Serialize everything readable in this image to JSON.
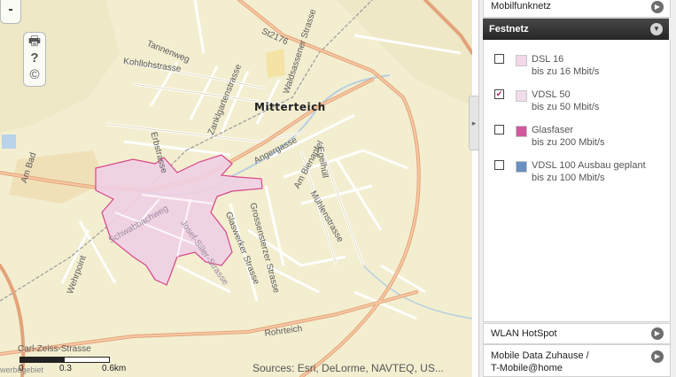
{
  "map": {
    "town_name": "Mitterteich",
    "street_labels": [
      {
        "id": "tannenweg",
        "text": "Tannenweg"
      },
      {
        "id": "kohllohstrasse",
        "text": "Kohllohstrasse"
      },
      {
        "id": "st2176",
        "text": "St2176"
      },
      {
        "id": "waldsassener-strasse",
        "text": "Waldsassener Strasse"
      },
      {
        "id": "zanklgartenstrasse",
        "text": "Zanklgartenstrasse"
      },
      {
        "id": "erbstrasse",
        "text": "Erbstrasse"
      },
      {
        "id": "angergasse",
        "text": "Angergasse"
      },
      {
        "id": "am-bienapfel",
        "text": "Am Bienapfel"
      },
      {
        "id": "egelhull",
        "text": "Egelhüll"
      },
      {
        "id": "muhlenstrasse",
        "text": "Mühlenstrasse"
      },
      {
        "id": "am-bad",
        "text": "Am Bad"
      },
      {
        "id": "schwabbachweg",
        "text": "Schwabbachweg"
      },
      {
        "id": "josef-siller-strasse",
        "text": "Josef-Siller-Strasse"
      },
      {
        "id": "glaswerkerstrasse",
        "text": "Glaswerker Strasse"
      },
      {
        "id": "grossensterzer-strasse",
        "text": "Grossensterzer Strasse"
      },
      {
        "id": "wehrpoint",
        "text": "Wehrpoint"
      },
      {
        "id": "rohrteich",
        "text": "Rohrteich"
      },
      {
        "id": "carl-zeiss-strasse",
        "text": "Carl-Zeiss-Strasse"
      },
      {
        "id": "gewerbegebiet",
        "text": "werbegebiet"
      }
    ],
    "zoom_out_label": "-",
    "tools": [
      {
        "name": "print-icon",
        "glyph": "🖶"
      },
      {
        "name": "help-icon",
        "glyph": "?"
      },
      {
        "name": "copyright-icon",
        "glyph": "©"
      }
    ],
    "scale": {
      "labels": [
        "0",
        "0.3",
        "0.6km"
      ]
    },
    "sources": "Sources: Esri, DeLorme, NAVTEQ, US..."
  },
  "panel": {
    "mobilfunknetz": "Mobilfunknetz",
    "festnetz": "Festnetz",
    "festnetz_items": [
      {
        "label": "DSL 16",
        "sub": "bis zu 16 Mbit/s",
        "checked": false,
        "color": "#f3d6ea"
      },
      {
        "label": "VDSL 50",
        "sub": "bis zu 50 Mbit/s",
        "checked": true,
        "color": "#f0dcea"
      },
      {
        "label": "Glasfaser",
        "sub": "bis zu 200 Mbit/s",
        "checked": false,
        "color": "#d0589c"
      },
      {
        "label": "VDSL 100 Ausbau geplant",
        "sub": "bis zu 100 Mbit/s",
        "checked": false,
        "color": "#6a8fc0"
      }
    ],
    "wlan_hotspot": "WLAN HotSpot",
    "mobile_data_line1": "Mobile Data Zuhause /",
    "mobile_data_line2": "T-Mobile@home"
  },
  "colors": {
    "map_bg": "#f3eed0",
    "coverage_fill": "#efcfe3",
    "coverage_stroke": "#d6458a",
    "main_road": "#e8a87c",
    "panel_header": "#333333"
  }
}
